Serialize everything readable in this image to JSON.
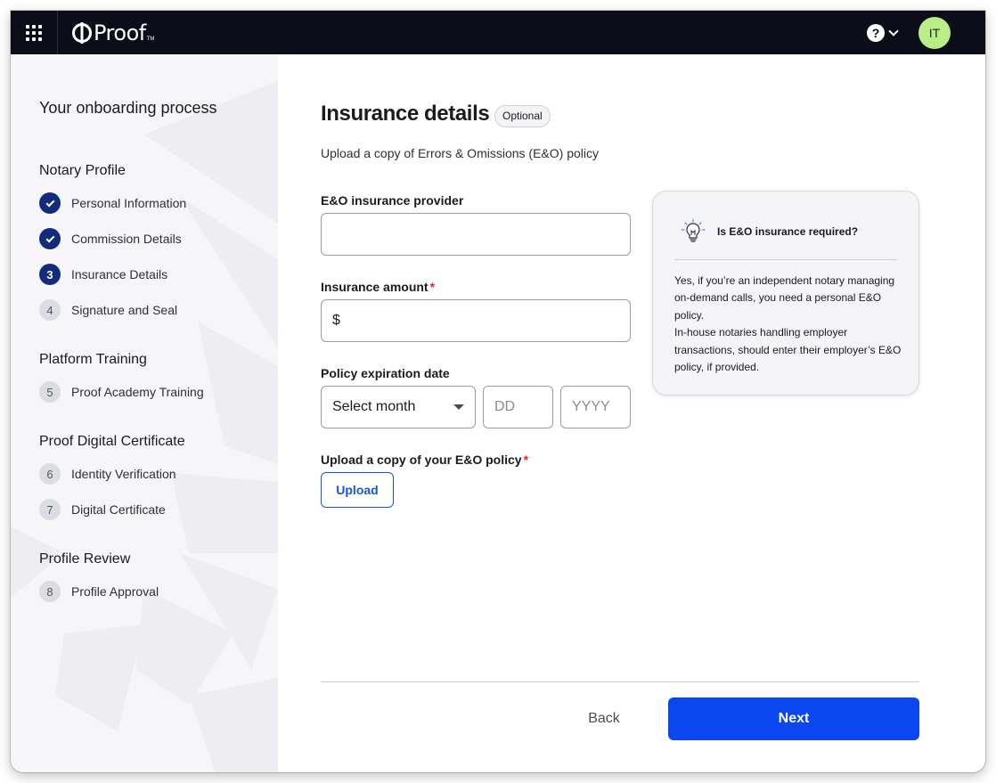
{
  "topbar": {
    "logo_text": "Proof",
    "logo_tm": "TM",
    "avatar_initials": "IT",
    "help_icon": "?"
  },
  "sidebar": {
    "title": "Your onboarding process",
    "sections": [
      {
        "title": "Notary Profile",
        "steps": [
          {
            "number": "1",
            "label": "Personal Information",
            "status": "done"
          },
          {
            "number": "2",
            "label": "Commission Details",
            "status": "done"
          },
          {
            "number": "3",
            "label": "Insurance Details",
            "status": "current"
          },
          {
            "number": "4",
            "label": "Signature and Seal",
            "status": "todo"
          }
        ]
      },
      {
        "title": "Platform Training",
        "steps": [
          {
            "number": "5",
            "label": "Proof Academy Training",
            "status": "todo"
          }
        ]
      },
      {
        "title": "Proof Digital Certificate",
        "steps": [
          {
            "number": "6",
            "label": "Identity Verification",
            "status": "todo"
          },
          {
            "number": "7",
            "label": "Digital Certificate",
            "status": "todo"
          }
        ]
      },
      {
        "title": "Profile Review",
        "steps": [
          {
            "number": "8",
            "label": "Profile Approval",
            "status": "todo"
          }
        ]
      }
    ]
  },
  "main": {
    "title": "Insurance details",
    "optional_badge": "Optional",
    "subtitle": "Upload a copy of Errors & Omissions (E&O) policy",
    "provider": {
      "label": "E&O insurance provider",
      "value": ""
    },
    "amount": {
      "label": "Insurance amount",
      "required_mark": "*",
      "currency": "$",
      "value": ""
    },
    "expiration": {
      "label": "Policy expiration date",
      "month_selected": "Select month",
      "day_placeholder": "DD",
      "year_placeholder": "YYYY"
    },
    "upload": {
      "label": "Upload a copy of your E&O policy",
      "required_mark": "*",
      "button": "Upload"
    },
    "info_card": {
      "title": "Is E&O insurance required?",
      "body_1": "Yes, if you’re an independent notary managing on-demand calls, you need a personal E&O policy.",
      "body_2": "In-house notaries handling employer transactions, should enter their employer’s E&O policy, if provided."
    },
    "footer": {
      "back": "Back",
      "next": "Next"
    }
  },
  "colors": {
    "topbar_bg": "#0b0d18",
    "primary": "#0a47f0",
    "step_done": "#132b7b",
    "avatar_bg": "#b9ee86",
    "required": "#d42b2b"
  }
}
